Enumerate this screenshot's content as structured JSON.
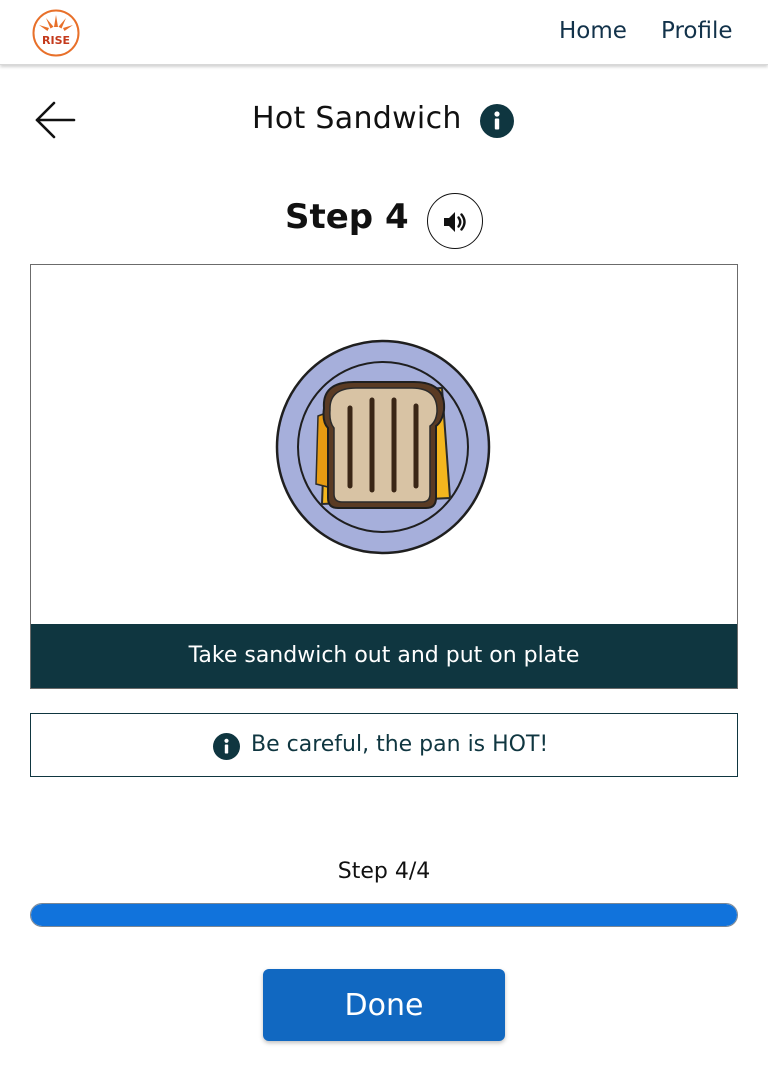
{
  "nav": {
    "logo_text": "RISE",
    "home_label": "Home",
    "profile_label": "Profile"
  },
  "header": {
    "title": "Hot Sandwich"
  },
  "step": {
    "title": "Step 4",
    "caption": "Take sandwich out and put on plate",
    "image_icon": "sandwich-on-plate"
  },
  "tip": {
    "icon": "info-icon",
    "text": "Be careful, the pan is HOT!"
  },
  "progress": {
    "label": "Step 4/4",
    "current": 4,
    "total": 4
  },
  "actions": {
    "done_label": "Done"
  },
  "colors": {
    "primary": "#1168c1",
    "progress": "#1173dc",
    "dark_teal": "#0f3640",
    "logo_orange": "#e8702a"
  }
}
